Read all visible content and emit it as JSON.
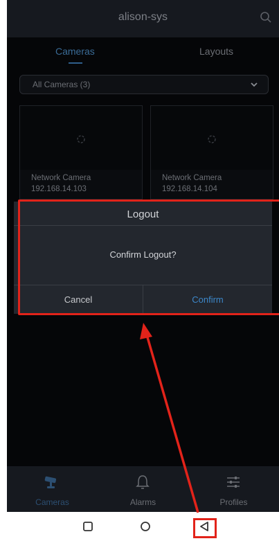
{
  "header": {
    "title": "alison-sys",
    "search_icon": "search-icon"
  },
  "tabs": [
    {
      "label": "Cameras",
      "active": true
    },
    {
      "label": "Layouts",
      "active": false
    }
  ],
  "filter": {
    "selected": "All Cameras (3)",
    "icon": "chevron-down-icon"
  },
  "cameras": [
    {
      "name": "Network Camera",
      "ip": "192.168.14.103"
    },
    {
      "name": "Network Camera",
      "ip": "192.168.14.104"
    }
  ],
  "dialog": {
    "title": "Logout",
    "message": "Confirm Logout?",
    "cancel_label": "Cancel",
    "confirm_label": "Confirm"
  },
  "bottom_nav": [
    {
      "label": "Cameras",
      "icon": "camera-icon",
      "active": true
    },
    {
      "label": "Alarms",
      "icon": "bell-icon",
      "active": false
    },
    {
      "label": "Profiles",
      "icon": "sliders-icon",
      "active": false
    }
  ],
  "system_nav": {
    "icons": [
      "recent-apps-icon",
      "home-icon",
      "back-icon"
    ]
  },
  "colors": {
    "accent": "#3c87c9",
    "background": "#050608",
    "dialog": "#23272e",
    "annotation": "#e2231a"
  }
}
